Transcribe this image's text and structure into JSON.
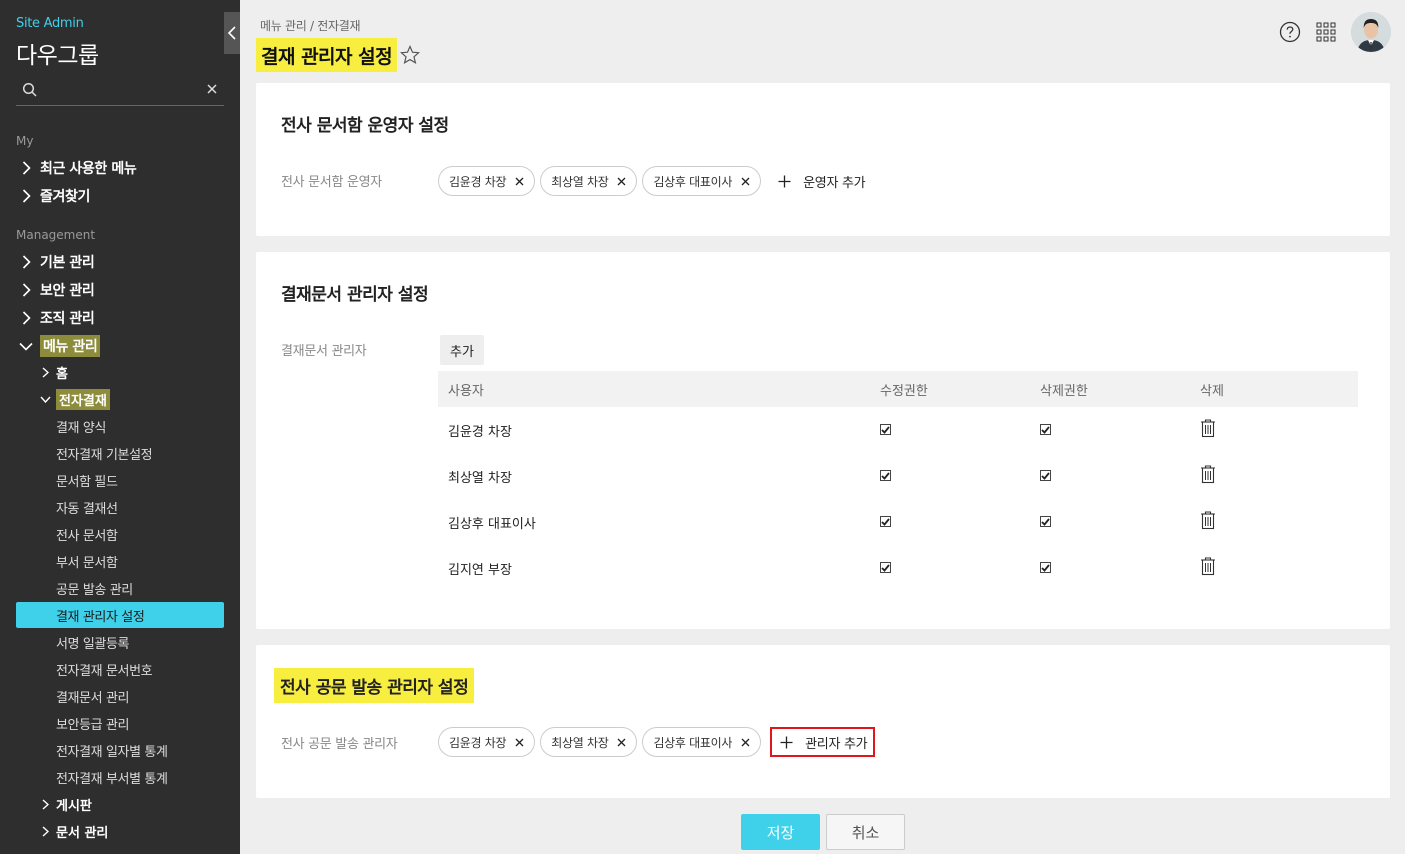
{
  "sidebar": {
    "site_admin": "Site Admin",
    "company": "다우그룹",
    "search_placeholder": "",
    "my_label": "My",
    "my_items": [
      "최근 사용한 메뉴",
      "즐겨찾기"
    ],
    "management_label": "Management",
    "mgmt_items": [
      "기본 관리",
      "보안 관리",
      "조직 관리",
      "메뉴 관리"
    ],
    "menu_sub": [
      "홈",
      "전자결재"
    ],
    "approval_items": [
      "결재 양식",
      "전자결재 기본설정",
      "문서함 필드",
      "자동 결재선",
      "전사 문서함",
      "부서 문서함",
      "공문 발송 관리",
      "결재 관리자 설정",
      "서명 일괄등록",
      "전자결재 문서번호",
      "결재문서 관리",
      "보안등급 관리",
      "전자결재 일자별 통계",
      "전자결재 부서별 통계"
    ],
    "more_items": [
      "게시판",
      "문서 관리"
    ]
  },
  "header": {
    "breadcrumb": "메뉴 관리 / 전자결재",
    "title": "결재 관리자 설정"
  },
  "section1": {
    "title": "전사 문서함 운영자 설정",
    "field_label": "전사 문서함 운영자",
    "chips": [
      "김윤경 차장",
      "최상열 차장",
      "김상후 대표이사"
    ],
    "add_label": "운영자 추가"
  },
  "section2": {
    "title": "결재문서 관리자 설정",
    "field_label": "결재문서 관리자",
    "add_button": "추가",
    "columns": [
      "사용자",
      "수정권한",
      "삭제권한",
      "삭제"
    ],
    "rows": [
      {
        "user": "김윤경 차장",
        "modify": true,
        "delete": true
      },
      {
        "user": "최상열 차장",
        "modify": true,
        "delete": true
      },
      {
        "user": "김상후 대표이사",
        "modify": true,
        "delete": true
      },
      {
        "user": "김지연 부장",
        "modify": true,
        "delete": true
      }
    ]
  },
  "section3": {
    "title": "전사 공문 발송 관리자 설정",
    "field_label": "전사 공문 발송 관리자",
    "chips": [
      "김윤경 차장",
      "최상열 차장",
      "김상후 대표이사"
    ],
    "add_label": "관리자 추가"
  },
  "footer": {
    "save": "저장",
    "cancel": "취소"
  },
  "colors": {
    "accent": "#3fd0ea",
    "highlight": "#f7ee40",
    "sidebar_bg": "#2e2e2e",
    "olive_highlight": "#8c8c3a",
    "focus_box": "#e0161b"
  }
}
